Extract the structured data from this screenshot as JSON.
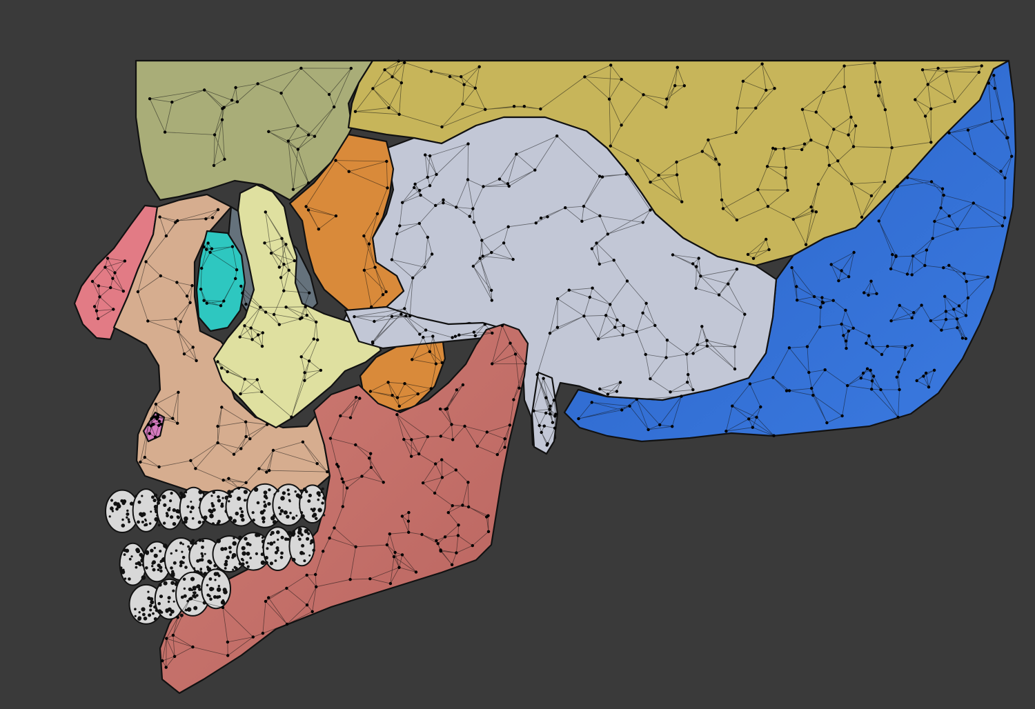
{
  "viewport": {
    "background": "#3a3a3a",
    "view": "left-lateral",
    "shading": "solid-with-wireframe"
  },
  "mesh": {
    "edge_color": "#111111",
    "vertex_color": "#000000",
    "regions": [
      {
        "id": "frontal",
        "color": "#a9ad78"
      },
      {
        "id": "parietal",
        "color": "#c7b55a"
      },
      {
        "id": "occipital",
        "color": "#2f6fd0"
      },
      {
        "id": "temporal",
        "color": "#c2c7d6"
      },
      {
        "id": "sphenoid",
        "color": "#d98a3a"
      },
      {
        "id": "nasal",
        "color": "#e27b85"
      },
      {
        "id": "lacrimal",
        "color": "#2ec7c0"
      },
      {
        "id": "orbit-interior",
        "color": "#65727c"
      },
      {
        "id": "zygomatic",
        "color": "#dfe0a0"
      },
      {
        "id": "maxilla",
        "color": "#d6ad8f"
      },
      {
        "id": "mandible",
        "color": "#c4726d"
      },
      {
        "id": "teeth",
        "color": "#d8d8d8"
      },
      {
        "id": "vomer-fragment",
        "color": "#d67bbf"
      }
    ]
  }
}
